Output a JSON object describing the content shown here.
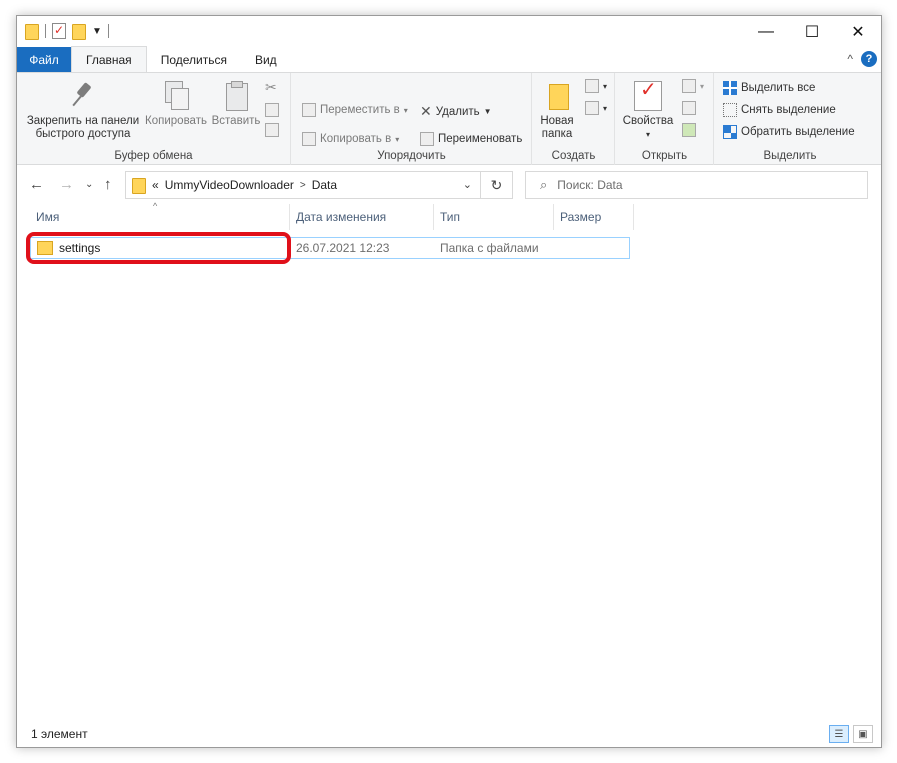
{
  "window": {
    "controls": {
      "minimize": "—",
      "maximize": "☐",
      "close": "✕"
    }
  },
  "ribbon_tabs": [
    {
      "label": "Файл"
    },
    {
      "label": "Главная"
    },
    {
      "label": "Поделиться"
    },
    {
      "label": "Вид"
    }
  ],
  "ribbon": {
    "clipboard": {
      "label": "Буфер обмена",
      "pin": "Закрепить на панели быстрого доступа",
      "pin_line1": "Закрепить на панели",
      "pin_line2": "быстрого доступа",
      "copy": "Копировать",
      "paste": "Вставить"
    },
    "organize": {
      "label": "Упорядочить",
      "move_to": "Переместить в",
      "copy_to": "Копировать в",
      "delete": "Удалить",
      "rename": "Переименовать"
    },
    "create": {
      "label": "Создать",
      "new_folder_line1": "Новая",
      "new_folder_line2": "папка"
    },
    "open": {
      "label": "Открыть",
      "properties": "Свойства"
    },
    "select": {
      "label": "Выделить",
      "select_all": "Выделить все",
      "select_none": "Снять выделение",
      "invert": "Обратить выделение"
    }
  },
  "address": {
    "prefix": "«",
    "crumbs": [
      "UmmyVideoDownloader",
      "Data"
    ],
    "separator": ">"
  },
  "search": {
    "placeholder": "Поиск: Data"
  },
  "columns": [
    {
      "label": "Имя"
    },
    {
      "label": "Дата изменения"
    },
    {
      "label": "Тип"
    },
    {
      "label": "Размер"
    }
  ],
  "files": [
    {
      "name": "settings",
      "modified": "26.07.2021 12:23",
      "type": "Папка с файлами",
      "size": ""
    }
  ],
  "status": {
    "count": "1 элемент"
  },
  "colors": {
    "accent": "#1a6dc0",
    "highlight": "#e0101a",
    "selection_border": "#99d1ff"
  }
}
